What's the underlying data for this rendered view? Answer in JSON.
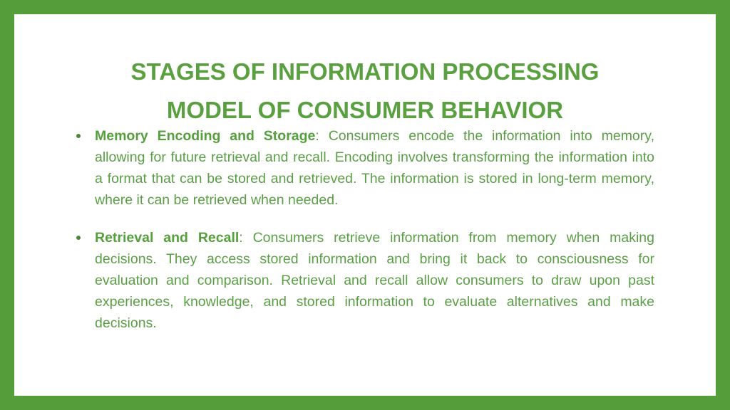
{
  "slide": {
    "title_lines": [
      "STAGES OF INFORMATION PROCESSING",
      "MODEL OF CONSUMER BEHAVIOR"
    ],
    "bullets": [
      {
        "term": "Memory Encoding and Storage",
        "separator": ": ",
        "text": "Consumers encode the information into memory, allowing for future retrieval and recall. Encoding involves transforming the information into a format that can be stored and retrieved. The information is stored in long-term memory, where it can be retrieved when needed."
      },
      {
        "term": "Retrieval and Recall",
        "separator": ": ",
        "text": "Consumers retrieve information from memory when making decisions. They access stored information and bring it back to consciousness for evaluation and comparison. Retrieval and recall allow consumers to draw upon past experiences, knowledge, and stored information to evaluate alternatives and make decisions."
      }
    ]
  },
  "colors": {
    "frame": "#559d3b",
    "text": "#5a9e45",
    "background": "#ffffff"
  }
}
